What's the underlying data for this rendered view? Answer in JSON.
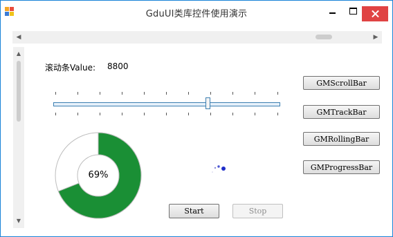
{
  "window": {
    "title": "GduUI类库控件使用演示"
  },
  "scroll": {
    "label": "滚动条Value:",
    "value": "8800"
  },
  "trackbar": {
    "value_fraction": 0.69
  },
  "buttons": {
    "scrollbar": "GMScrollBar",
    "trackbar": "GMTrackBar",
    "rollingbar": "GMRollingBar",
    "progressbar": "GMProgressBar",
    "start": "Start",
    "stop": "Stop"
  },
  "progress": {
    "percent_text": "69%",
    "fraction": 0.69,
    "fill_color": "#1a8f35"
  },
  "loader": {
    "dot_color": "#1f2ec9"
  },
  "icons": {
    "app": "app-icon",
    "minimize": "minimize-icon",
    "maximize": "maximize-icon",
    "close": "close-icon"
  }
}
